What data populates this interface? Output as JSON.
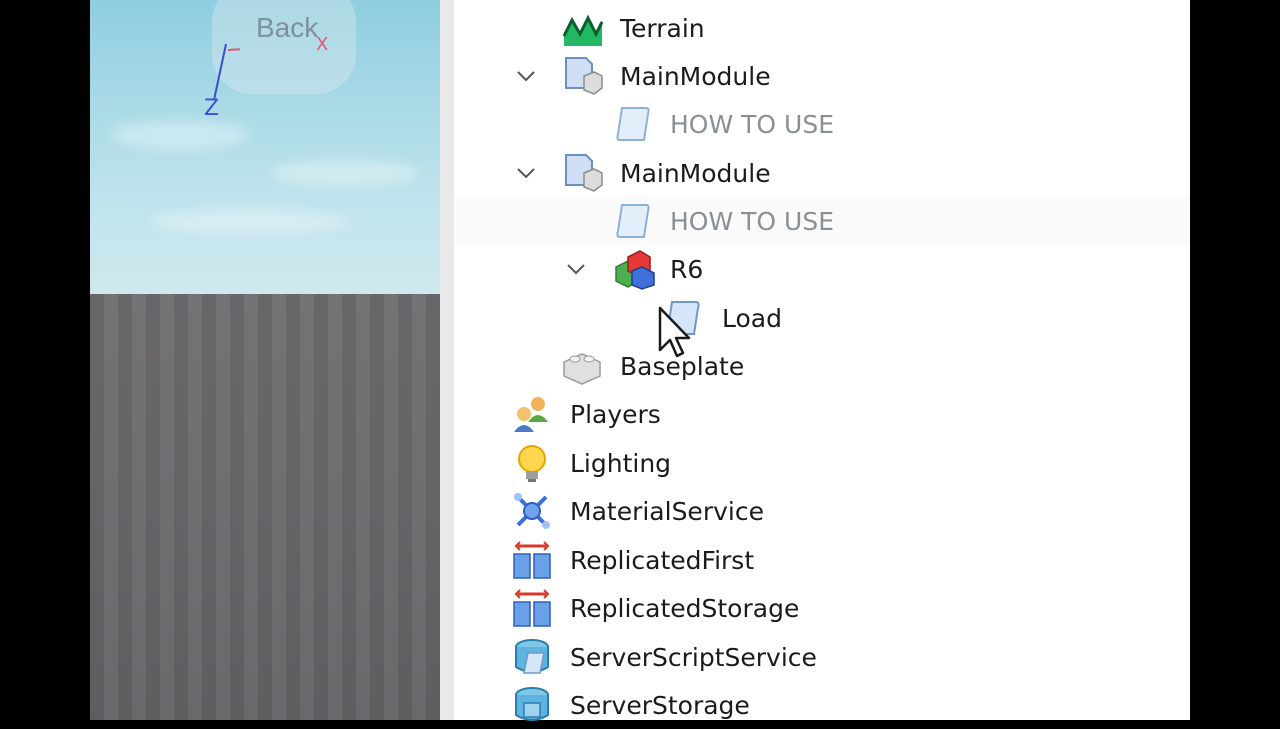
{
  "viewport": {
    "back_label": "Back",
    "axis_z": "Z",
    "axis_x": "X"
  },
  "explorer": {
    "rows": [
      {
        "label": "Terrain",
        "icon": "terrain-icon"
      },
      {
        "label": "MainModule",
        "icon": "module-script-icon",
        "expanded": true
      },
      {
        "label": "HOW TO USE",
        "icon": "script-icon",
        "disabled": true
      },
      {
        "label": "MainModule",
        "icon": "module-script-icon",
        "expanded": true
      },
      {
        "label": "HOW TO USE",
        "icon": "script-icon",
        "disabled": true
      },
      {
        "label": "R6",
        "icon": "model-icon",
        "expanded": true
      },
      {
        "label": "Load",
        "icon": "script-icon"
      },
      {
        "label": "Baseplate",
        "icon": "part-icon"
      },
      {
        "label": "Players",
        "icon": "players-icon"
      },
      {
        "label": "Lighting",
        "icon": "lighting-icon"
      },
      {
        "label": "MaterialService",
        "icon": "material-service-icon"
      },
      {
        "label": "ReplicatedFirst",
        "icon": "replicated-first-icon"
      },
      {
        "label": "ReplicatedStorage",
        "icon": "replicated-storage-icon"
      },
      {
        "label": "ServerScriptService",
        "icon": "server-script-service-icon"
      },
      {
        "label": "ServerStorage",
        "icon": "server-storage-icon"
      }
    ]
  },
  "colors": {
    "sky": "#a5d8e6",
    "ground": "#6a686b",
    "panel": "#ffffff",
    "text": "#1b1b1b",
    "disabled_text": "#8a8f95"
  }
}
